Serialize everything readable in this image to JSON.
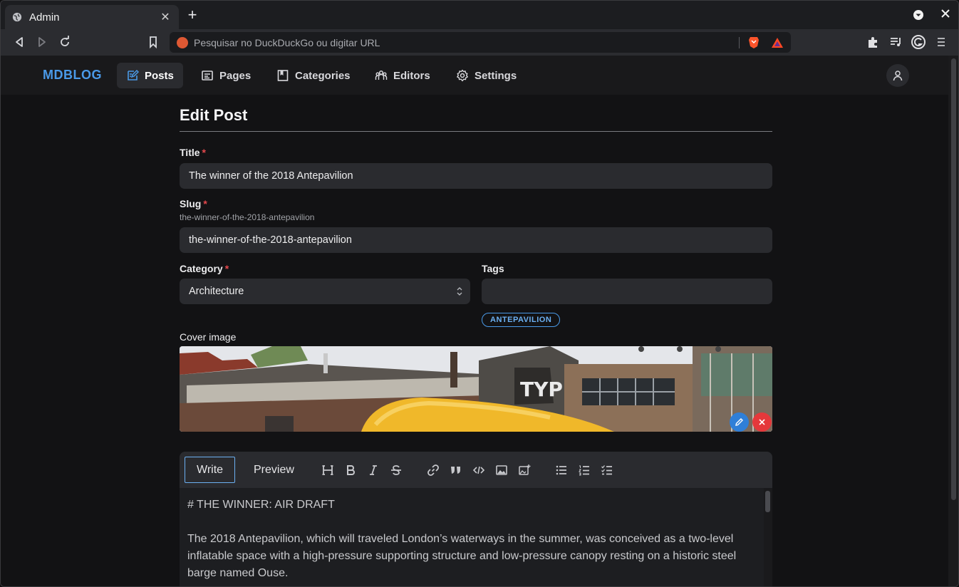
{
  "browser": {
    "tab_title": "Admin",
    "url_placeholder": "Pesquisar no DuckDuckGo ou digitar URL"
  },
  "app": {
    "brand": "MDBLOG",
    "nav": [
      {
        "label": "Posts",
        "icon": "edit-icon",
        "active": true
      },
      {
        "label": "Pages",
        "icon": "pages-icon",
        "active": false
      },
      {
        "label": "Categories",
        "icon": "bookmark-icon",
        "active": false
      },
      {
        "label": "Editors",
        "icon": "users-icon",
        "active": false
      },
      {
        "label": "Settings",
        "icon": "gear-icon",
        "active": false
      }
    ]
  },
  "form": {
    "heading": "Edit Post",
    "title_label": "Title",
    "title_value": "The winner of the 2018 Antepavilion",
    "slug_label": "Slug",
    "slug_hint": "the-winner-of-the-2018-antepavilion",
    "slug_value": "the-winner-of-the-2018-antepavilion",
    "category_label": "Category",
    "category_value": "Architecture",
    "tags_label": "Tags",
    "tags_value": "",
    "tags": [
      "ANTEPAVILION"
    ],
    "cover_label": "Cover image",
    "required_mark": "*"
  },
  "editor": {
    "tab_write": "Write",
    "tab_preview": "Preview",
    "content_line1": "# THE WINNER: AIR DRAFT",
    "content_para": "The 2018 Antepavilion, which will traveled London’s waterways in the summer, was conceived as a two-level inflatable space with a high-pressure supporting structure and low-pressure canopy resting on a historic steel barge named Ouse."
  },
  "colors": {
    "accent": "#4a9ae8",
    "required": "#e5484d",
    "edit_button": "#2f7fd8",
    "remove_button": "#e5383b"
  }
}
